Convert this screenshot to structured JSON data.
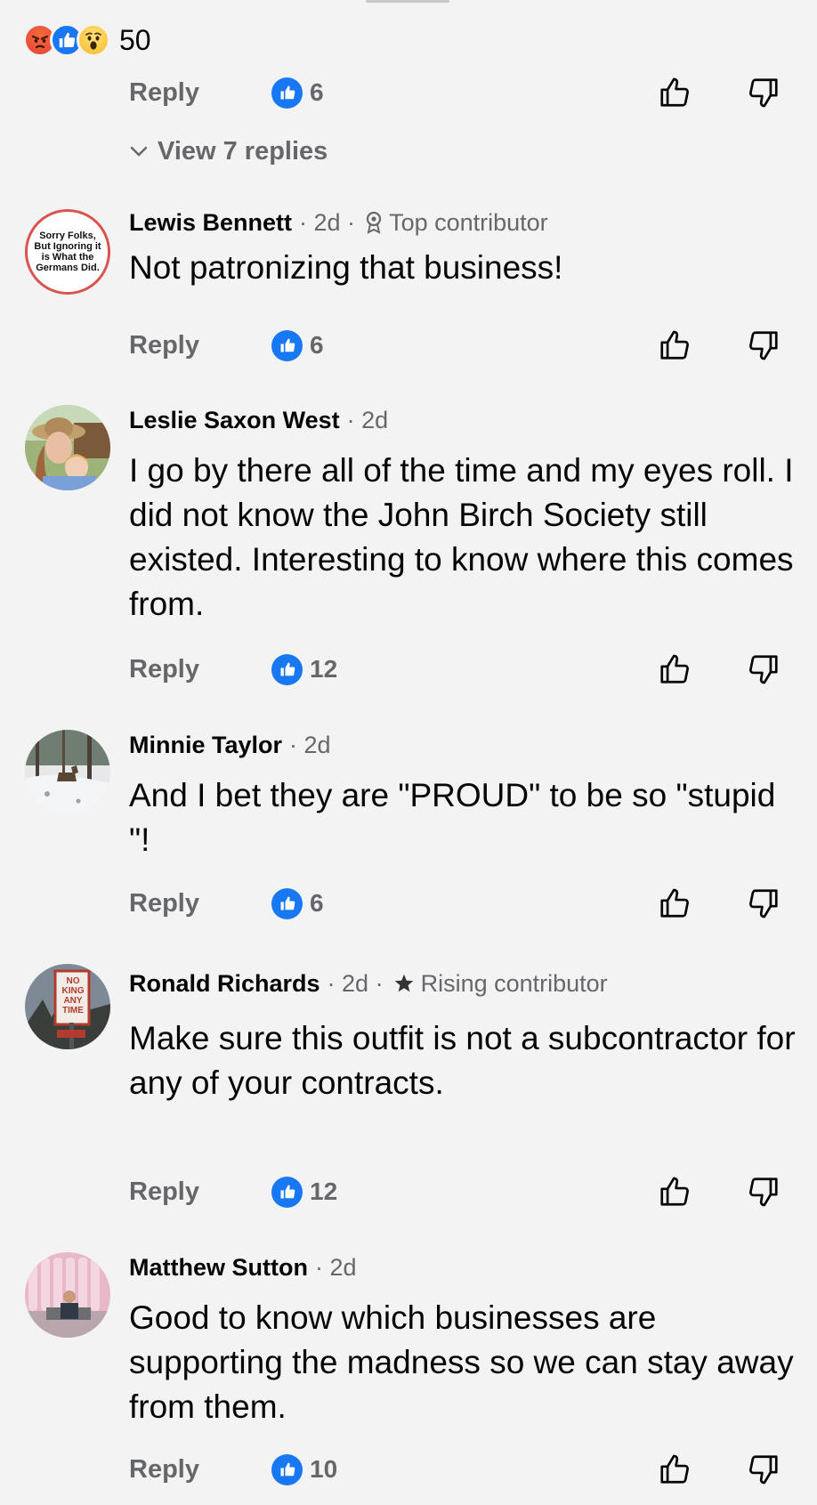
{
  "reaction_summary": {
    "icons": [
      "angry-icon",
      "like-icon",
      "wow-icon"
    ],
    "total": "50"
  },
  "reply_label": "Reply",
  "view_replies": "View 7 replies",
  "first_action": {
    "likes": "6"
  },
  "colors": {
    "accent": "#1877f2",
    "muted": "#65676b",
    "background": "#f3f3f3"
  },
  "comments": [
    {
      "author": "Lewis Bennett",
      "time": "· 2d ·",
      "badge": "Top contributor",
      "badge_icon": "award-icon",
      "text": "Not patronizing that business!",
      "likes": "6",
      "avatar_text": "Sorry Folks, But Ignoring it is What the Germans Did."
    },
    {
      "author": "Leslie Saxon West",
      "time": "· 2d",
      "text": "I go by there all of the time and my eyes roll.  I did not know the John Birch Society still existed.  Interesting to know where this comes from.",
      "likes": "12"
    },
    {
      "author": "Minnie Taylor",
      "time": "· 2d",
      "text": "And I bet they are \"PROUD\" to be so \"stupid \"!",
      "likes": "6"
    },
    {
      "author": "Ronald Richards",
      "time": "· 2d ·",
      "badge": "Rising contributor",
      "badge_icon": "star-icon",
      "text": "Make sure this outfit is not a subcontractor for any of your contracts.",
      "likes": "12",
      "avatar_text": "NO KING ANY TIME"
    },
    {
      "author": "Matthew Sutton",
      "time": "· 2d",
      "text": "Good to know which businesses are supporting the madness so we can stay away from them.",
      "likes": "10"
    }
  ]
}
